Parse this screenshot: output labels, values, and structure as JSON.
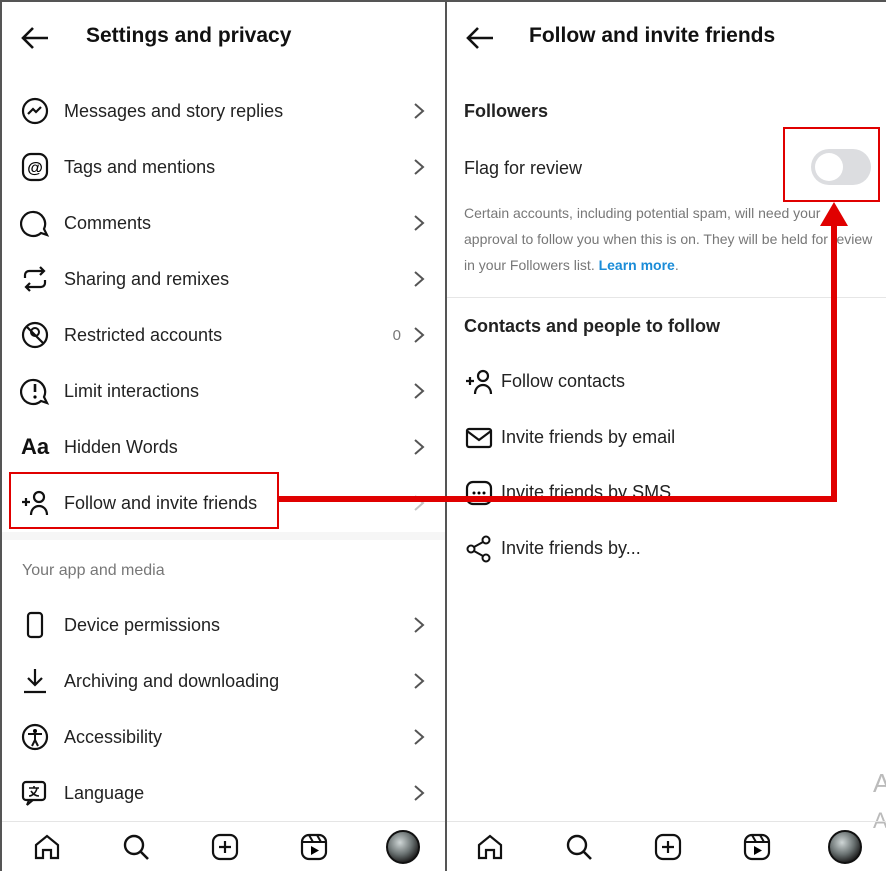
{
  "left": {
    "title": "Settings and privacy",
    "items": [
      {
        "label": "Messages and story replies",
        "icon": "messenger-icon"
      },
      {
        "label": "Tags and mentions",
        "icon": "at-icon"
      },
      {
        "label": "Comments",
        "icon": "comment-icon"
      },
      {
        "label": "Sharing and remixes",
        "icon": "repost-icon"
      },
      {
        "label": "Restricted accounts",
        "icon": "restricted-icon",
        "count": "0"
      },
      {
        "label": "Limit interactions",
        "icon": "alert-icon"
      },
      {
        "label": "Hidden Words",
        "icon": "text-aa-icon",
        "glyph": "Aa"
      },
      {
        "label": "Follow and invite friends",
        "icon": "add-person-icon"
      }
    ],
    "section2": "Your app and media",
    "items2": [
      {
        "label": "Device permissions",
        "icon": "phone-icon"
      },
      {
        "label": "Archiving and downloading",
        "icon": "download-icon"
      },
      {
        "label": "Accessibility",
        "icon": "accessibility-icon"
      },
      {
        "label": "Language",
        "icon": "language-icon"
      }
    ]
  },
  "right": {
    "title": "Follow and invite friends",
    "followers_header": "Followers",
    "flag_label": "Flag for review",
    "flag_on": false,
    "description": "Certain accounts, including potential spam, will need your approval to follow you when this is on. They will be held for review in your Followers list.",
    "learn_more": "Learn more",
    "contacts_header": "Contacts and people to follow",
    "items": [
      {
        "label": "Follow contacts",
        "icon": "add-person-icon"
      },
      {
        "label": "Invite friends by email",
        "icon": "mail-icon"
      },
      {
        "label": "Invite friends by SMS",
        "icon": "sms-icon"
      },
      {
        "label": "Invite friends by...",
        "icon": "share-icon"
      }
    ]
  },
  "nav": [
    "home-icon",
    "search-icon",
    "create-icon",
    "reels-icon",
    "profile-avatar"
  ],
  "watermark": [
    "A",
    "A"
  ],
  "colors": {
    "highlight": "#e00000",
    "link": "#1a8cd8",
    "toggle_off": "#dcdde0"
  }
}
